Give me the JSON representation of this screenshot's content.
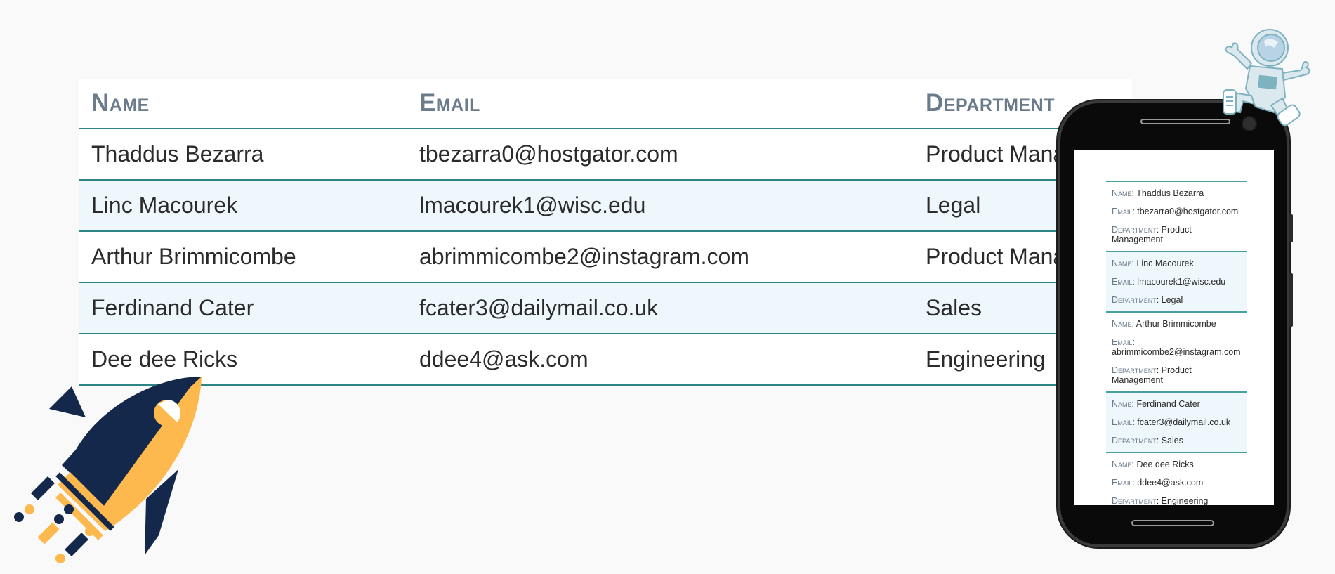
{
  "table": {
    "headers": {
      "name": "Name",
      "email": "Email",
      "department": "Department"
    },
    "rows": [
      {
        "name": "Thaddus Bezarra",
        "email": "tbezarra0@hostgator.com",
        "department": "Product Management"
      },
      {
        "name": "Linc Macourek",
        "email": "lmacourek1@wisc.edu",
        "department": "Legal"
      },
      {
        "name": "Arthur Brimmicombe",
        "email": "abrimmicombe2@instagram.com",
        "department": "Product Management"
      },
      {
        "name": "Ferdinand Cater",
        "email": "fcater3@dailymail.co.uk",
        "department": "Sales"
      },
      {
        "name": "Dee dee Ricks",
        "email": "ddee4@ask.com",
        "department": "Engineering"
      }
    ]
  },
  "mobile": {
    "keys": {
      "name": "Name",
      "email": "Email",
      "department": "Department"
    },
    "separator": ": "
  },
  "illustrations": {
    "rocket": "rocket-illustration",
    "astronaut": "astronaut-illustration",
    "phone": "phone-mockup"
  },
  "colors": {
    "background": "#f9f9f9",
    "header_text": "#6a7b8c",
    "divider": "#2e8585",
    "row_alt": "#eef7fc",
    "rocket_navy": "#13284a",
    "rocket_yellow": "#fdb94e",
    "astronaut_light": "#dbe8ee",
    "astronaut_accent": "#7fb2c0"
  }
}
